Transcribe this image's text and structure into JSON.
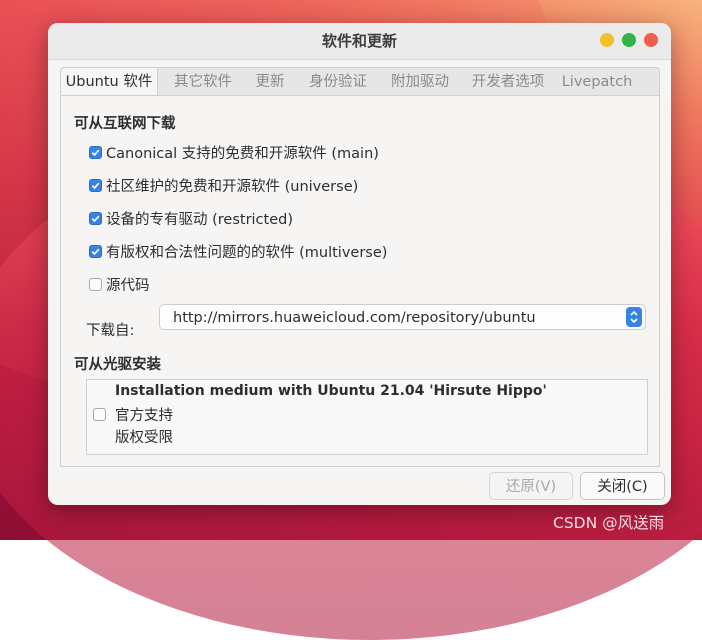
{
  "window": {
    "title": "软件和更新"
  },
  "tabs": [
    {
      "label": "Ubuntu 软件",
      "active": true
    },
    {
      "label": "其它软件"
    },
    {
      "label": "更新"
    },
    {
      "label": "身份验证"
    },
    {
      "label": "附加驱动"
    },
    {
      "label": "开发者选项"
    },
    {
      "label": "Livepatch"
    }
  ],
  "internet": {
    "heading": "可从互联网下载",
    "options": [
      {
        "label": "Canonical 支持的免费和开源软件 (main)",
        "checked": true
      },
      {
        "label": "社区维护的免费和开源软件 (universe)",
        "checked": true
      },
      {
        "label": "设备的专有驱动 (restricted)",
        "checked": true
      },
      {
        "label": "有版权和合法性问题的的软件 (multiverse)",
        "checked": true
      },
      {
        "label": "源代码",
        "checked": false
      }
    ],
    "download_from_label": "下载自:",
    "download_from_value": "http://mirrors.huaweicloud.com/repository/ubuntu"
  },
  "cdrom": {
    "heading": "可从光驱安装",
    "medium_title": "Installation medium with Ubuntu 21.04 'Hirsute Hippo'",
    "line2": "官方支持",
    "line3": "版权受限",
    "checked": false
  },
  "buttons": {
    "revert": "还原(V)",
    "close": "关闭(C)"
  },
  "watermark": "CSDN @风送雨",
  "colors": {
    "accent": "#3584e4",
    "close": "#ee5d4e",
    "minimize": "#f4bf2a",
    "maximize": "#2fb54a"
  }
}
